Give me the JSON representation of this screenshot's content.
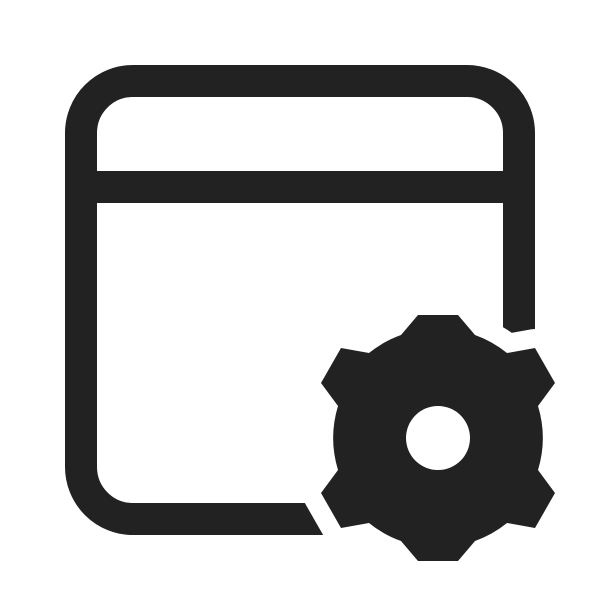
{
  "icon": {
    "name": "window-settings-icon",
    "parts": [
      "window-frame-icon",
      "gear-icon"
    ],
    "colors": {
      "background": "#ffffff",
      "foreground": "#222222"
    }
  }
}
